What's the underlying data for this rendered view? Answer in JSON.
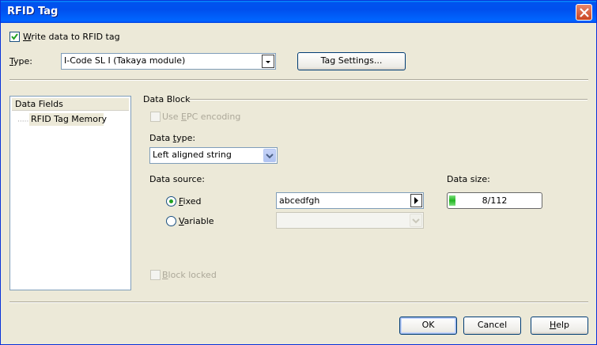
{
  "window": {
    "title": "RFID Tag"
  },
  "write_checkbox": {
    "label_underlined": "W",
    "label_rest": "rite data to RFID tag",
    "checked": true
  },
  "type": {
    "label_underlined": "T",
    "label_rest": "ype:",
    "value": "I-Code SL I (Takaya module)"
  },
  "tag_settings_button": "Tag Settings...",
  "tree": {
    "header": "Data Fields",
    "items": [
      {
        "label": "RFID Tag Memory",
        "selected": true
      }
    ]
  },
  "data_block": {
    "title": "Data Block",
    "epc": {
      "pre": "Use ",
      "underlined": "E",
      "post": "PC encoding",
      "enabled": false
    },
    "data_type": {
      "pre": "Data ",
      "underlined": "t",
      "post": "ype:",
      "value": "Left aligned string"
    },
    "data_source": {
      "label": "Data source:",
      "fixed": {
        "underlined": "F",
        "rest": "ixed",
        "selected": true
      },
      "variable": {
        "underlined": "V",
        "rest": "ariable",
        "selected": false
      }
    },
    "fixed_value": "abcedfgh",
    "data_size": {
      "label": "Data size:",
      "text": "8/112",
      "used": 8,
      "max": 112
    },
    "block_locked": {
      "underlined": "B",
      "rest": "lock locked",
      "enabled": false
    }
  },
  "buttons": {
    "ok": "OK",
    "cancel": "Cancel",
    "help_underlined": "H",
    "help_rest": "elp"
  },
  "colors": {
    "titlebar": "#0054e3",
    "progress_fill": "#22b422",
    "face": "#ece9d8"
  }
}
